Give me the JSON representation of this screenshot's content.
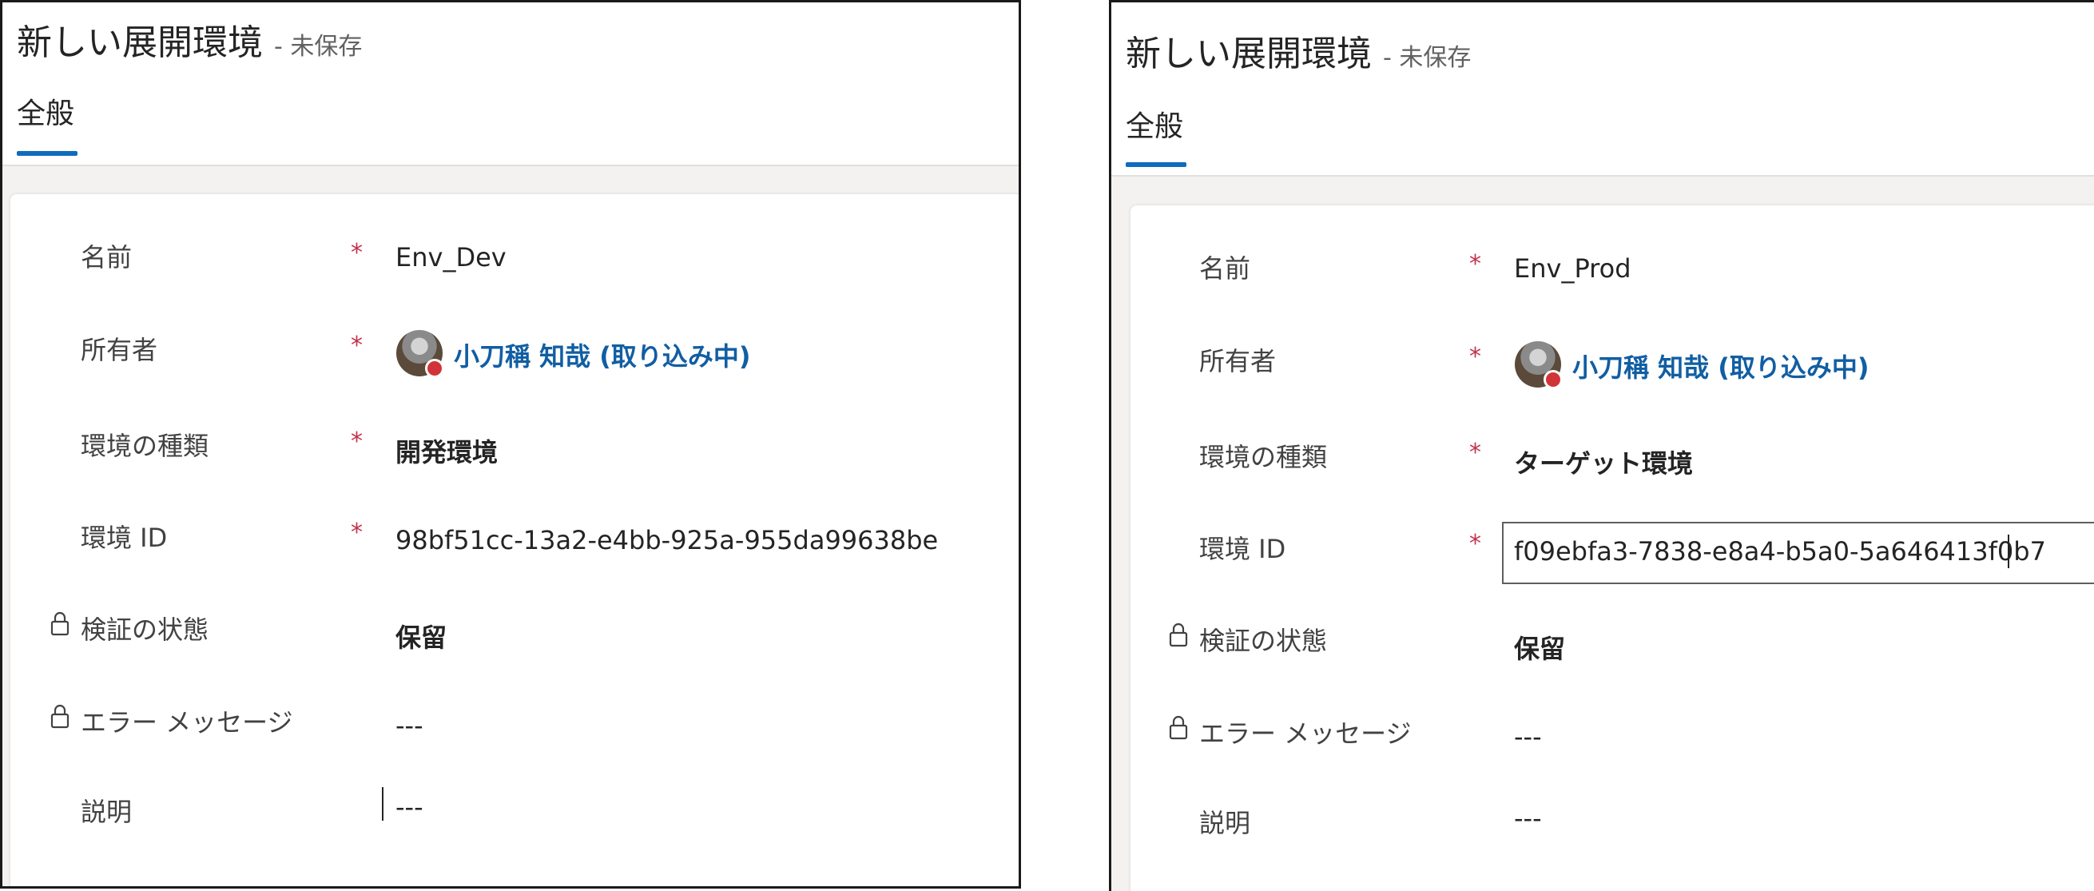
{
  "forms": [
    {
      "title": "新しい展開環境",
      "subtitle": "- 未保存",
      "tab": "全般",
      "fields": {
        "name": {
          "label": "名前",
          "required": "*",
          "value": "Env_Dev"
        },
        "owner": {
          "label": "所有者",
          "required": "*",
          "value": "小刀稱 知哉 (取り込み中)"
        },
        "type": {
          "label": "環境の種類",
          "required": "*",
          "value": "開発環境"
        },
        "env_id": {
          "label": "環境 ID",
          "required": "*",
          "value": "98bf51cc-13a2-e4bb-925a-955da99638be"
        },
        "validation": {
          "label": "検証の状態",
          "value": "保留"
        },
        "error": {
          "label": "エラー メッセージ",
          "value": "---"
        },
        "description": {
          "label": "説明",
          "value": "---"
        }
      }
    },
    {
      "title": "新しい展開環境",
      "subtitle": "- 未保存",
      "tab": "全般",
      "fields": {
        "name": {
          "label": "名前",
          "required": "*",
          "value": "Env_Prod"
        },
        "owner": {
          "label": "所有者",
          "required": "*",
          "value": "小刀稱 知哉 (取り込み中)"
        },
        "type": {
          "label": "環境の種類",
          "required": "*",
          "value": "ターゲット環境"
        },
        "env_id": {
          "label": "環境 ID",
          "required": "*",
          "value": "f09ebfa3-7838-e8a4-b5a0-5a646413f0b7"
        },
        "validation": {
          "label": "検証の状態",
          "value": "保留"
        },
        "error": {
          "label": "エラー メッセージ",
          "value": "---"
        },
        "description": {
          "label": "説明",
          "value": "---"
        }
      }
    }
  ],
  "colors": {
    "accent": "#0f6cbd",
    "link": "#115ea3",
    "required": "#c4314b",
    "presence_busy": "#d13438"
  }
}
